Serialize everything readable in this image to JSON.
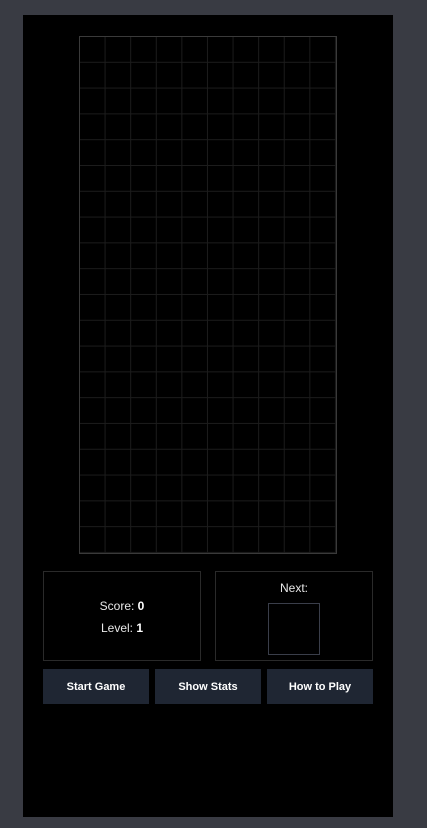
{
  "stats": {
    "score_label": "Score:",
    "score_value": "0",
    "level_label": "Level:",
    "level_value": "1"
  },
  "next": {
    "label": "Next:"
  },
  "buttons": {
    "start": "Start Game",
    "stats": "Show Stats",
    "help": "How to Play"
  },
  "board": {
    "columns": 10,
    "rows": 20
  },
  "colors": {
    "page_background": "#393b43",
    "panel_background": "#000000",
    "button_background": "#1f2633",
    "grid_line": "#1c1c1c"
  }
}
